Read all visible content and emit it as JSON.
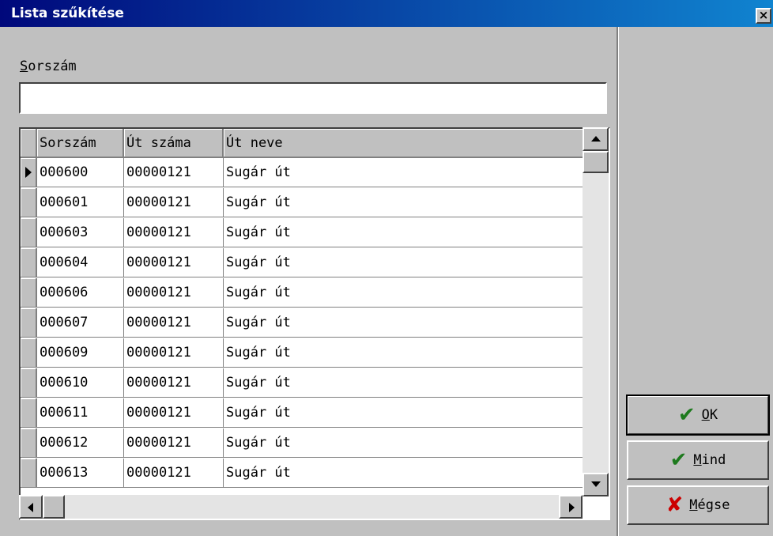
{
  "window": {
    "title": "Lista szűkítése",
    "close_label": "×"
  },
  "filter": {
    "label_first": "S",
    "label_rest": "orszám",
    "value": ""
  },
  "grid": {
    "columns": [
      "Sorszám",
      "Út száma",
      "Út neve"
    ],
    "rows": [
      [
        "000600",
        "00000121",
        "Sugár út"
      ],
      [
        "000601",
        "00000121",
        "Sugár út"
      ],
      [
        "000603",
        "00000121",
        "Sugár út"
      ],
      [
        "000604",
        "00000121",
        "Sugár út"
      ],
      [
        "000606",
        "00000121",
        "Sugár út"
      ],
      [
        "000607",
        "00000121",
        "Sugár út"
      ],
      [
        "000609",
        "00000121",
        "Sugár út"
      ],
      [
        "000610",
        "00000121",
        "Sugár út"
      ],
      [
        "000611",
        "00000121",
        "Sugár út"
      ],
      [
        "000612",
        "00000121",
        "Sugár út"
      ],
      [
        "000613",
        "00000121",
        "Sugár út"
      ]
    ],
    "selected_row": 0
  },
  "buttons": {
    "ok": {
      "accel": "O",
      "rest": "K",
      "icon": "check-icon",
      "color": "#1e7a1e"
    },
    "mind": {
      "accel": "M",
      "rest": "ind",
      "icon": "double-check-icon",
      "color": "#1e7a1e"
    },
    "megse": {
      "accel": "M",
      "rest": "égse",
      "icon": "cross-icon",
      "color": "#cc0000"
    }
  },
  "colors": {
    "titlebar_start": "#00087b",
    "titlebar_end": "#1084d0",
    "face": "#c0c0c0"
  }
}
